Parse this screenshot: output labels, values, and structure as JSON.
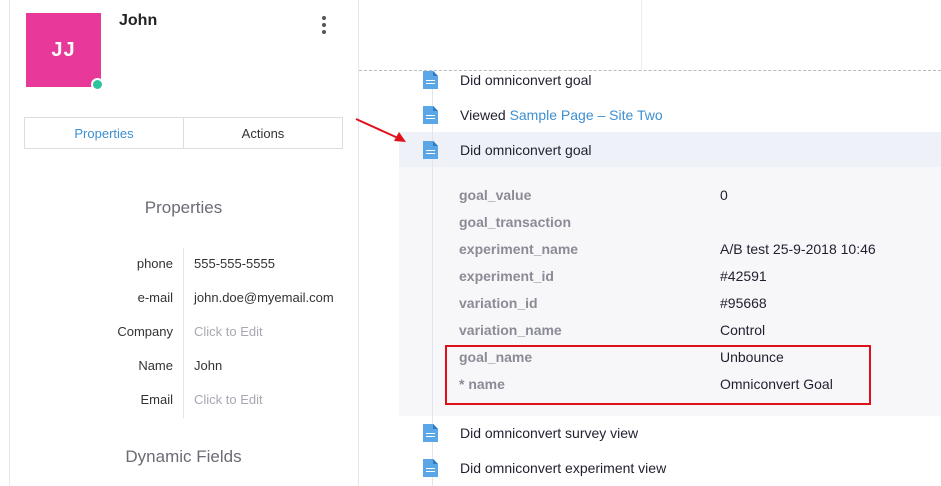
{
  "contact": {
    "initials": "JJ",
    "name": "John"
  },
  "tabs": {
    "properties": "Properties",
    "actions": "Actions"
  },
  "sections": {
    "properties": "Properties",
    "dynamic_fields": "Dynamic Fields"
  },
  "properties": [
    {
      "key": "phone",
      "value": "555-555-5555"
    },
    {
      "key": "e-mail",
      "value": "john.doe@myemail.com"
    },
    {
      "key": "Company",
      "value": "Click to Edit"
    },
    {
      "key": "Name",
      "value": "John"
    },
    {
      "key": "Email",
      "value": "Click to Edit"
    }
  ],
  "events": {
    "e0": "Did omniconvert goal",
    "e1_prefix": "Viewed",
    "e1_link": "Sample Page – Site Two",
    "e2": "Did omniconvert goal",
    "e3": "Did omniconvert survey view",
    "e4": "Did omniconvert experiment view"
  },
  "details": [
    {
      "key": "goal_value",
      "value": "0"
    },
    {
      "key": "goal_transaction",
      "value": ""
    },
    {
      "key": "experiment_name",
      "value": "A/B test 25-9-2018 10:46"
    },
    {
      "key": "experiment_id",
      "value": "#42591"
    },
    {
      "key": "variation_id",
      "value": "#95668"
    },
    {
      "key": "variation_name",
      "value": "Control"
    },
    {
      "key": "goal_name",
      "value": "Unbounce"
    },
    {
      "key": "* name",
      "value": "Omniconvert Goal"
    }
  ],
  "colors": {
    "avatar": "#e8399b",
    "online": "#2ec4a0",
    "link": "#3d8fd1",
    "annotation": "#e0101a"
  }
}
